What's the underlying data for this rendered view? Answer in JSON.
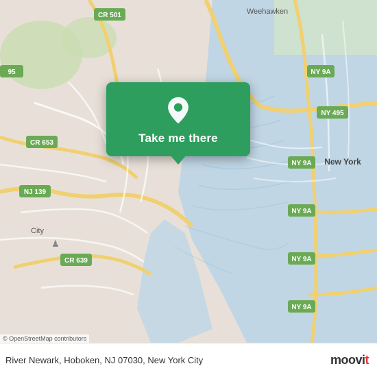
{
  "map": {
    "background_color": "#e8e0d8",
    "osm_credit": "© OpenStreetMap contributors"
  },
  "popup": {
    "button_label": "Take me there",
    "background_color": "#2e9e5e",
    "pin_color": "#ffffff"
  },
  "bottom_bar": {
    "address": "River Newark, Hoboken, NJ 07030, New York City",
    "logo_text": "moovit",
    "logo_dot_color": "#e8323c"
  }
}
